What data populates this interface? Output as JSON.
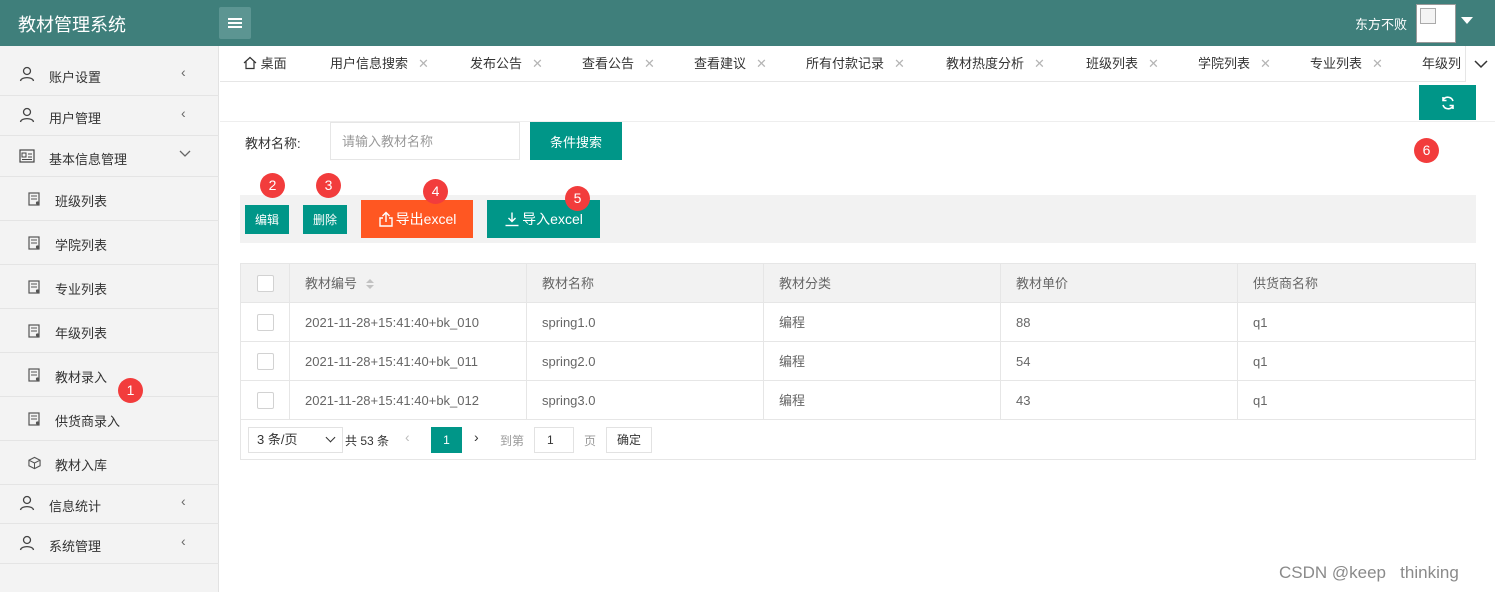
{
  "app": {
    "title": "教材管理系统"
  },
  "header": {
    "user_name": "东方不败"
  },
  "sidebar": {
    "items": [
      {
        "label": "账户设置"
      },
      {
        "label": "用户管理"
      },
      {
        "label": "基本信息管理"
      },
      {
        "label": "信息统计"
      },
      {
        "label": "系统管理"
      }
    ],
    "subitems": [
      {
        "label": "班级列表"
      },
      {
        "label": "学院列表"
      },
      {
        "label": "专业列表"
      },
      {
        "label": "年级列表"
      },
      {
        "label": "教材录入"
      },
      {
        "label": "供货商录入"
      },
      {
        "label": "教材入库"
      }
    ]
  },
  "tabs": [
    {
      "label": "桌面"
    },
    {
      "label": "用户信息搜索"
    },
    {
      "label": "发布公告"
    },
    {
      "label": "查看公告"
    },
    {
      "label": "查看建议"
    },
    {
      "label": "所有付款记录"
    },
    {
      "label": "教材热度分析"
    },
    {
      "label": "班级列表"
    },
    {
      "label": "学院列表"
    },
    {
      "label": "专业列表"
    },
    {
      "label": "年级列"
    }
  ],
  "search": {
    "label": "教材名称:",
    "placeholder": "请输入教材名称",
    "button": "条件搜索"
  },
  "toolbar": {
    "edit": "编辑",
    "delete": "删除",
    "export": "导出excel",
    "import": "导入excel"
  },
  "markers": [
    "1",
    "2",
    "3",
    "4",
    "5",
    "6"
  ],
  "table": {
    "headers": [
      "教材编号",
      "教材名称",
      "教材分类",
      "教材单价",
      "供货商名称"
    ],
    "rows": [
      [
        "2021-11-28+15:41:40+bk_010",
        "spring1.0",
        "编程",
        "88",
        "q1"
      ],
      [
        "2021-11-28+15:41:40+bk_011",
        "spring2.0",
        "编程",
        "54",
        "q1"
      ],
      [
        "2021-11-28+15:41:40+bk_012",
        "spring3.0",
        "编程",
        "43",
        "q1"
      ]
    ]
  },
  "pagination": {
    "page_size": "3 条/页",
    "total": "共 53 条",
    "current": "1",
    "goto_label": "到第",
    "goto_value": "1",
    "page_unit": "页",
    "confirm": "确定"
  },
  "watermark": "CSDN @keep   thinking",
  "colors": {
    "header": "#3f7f7b",
    "primary": "#009688",
    "danger": "#ff5722",
    "marker": "#f23c3c"
  }
}
